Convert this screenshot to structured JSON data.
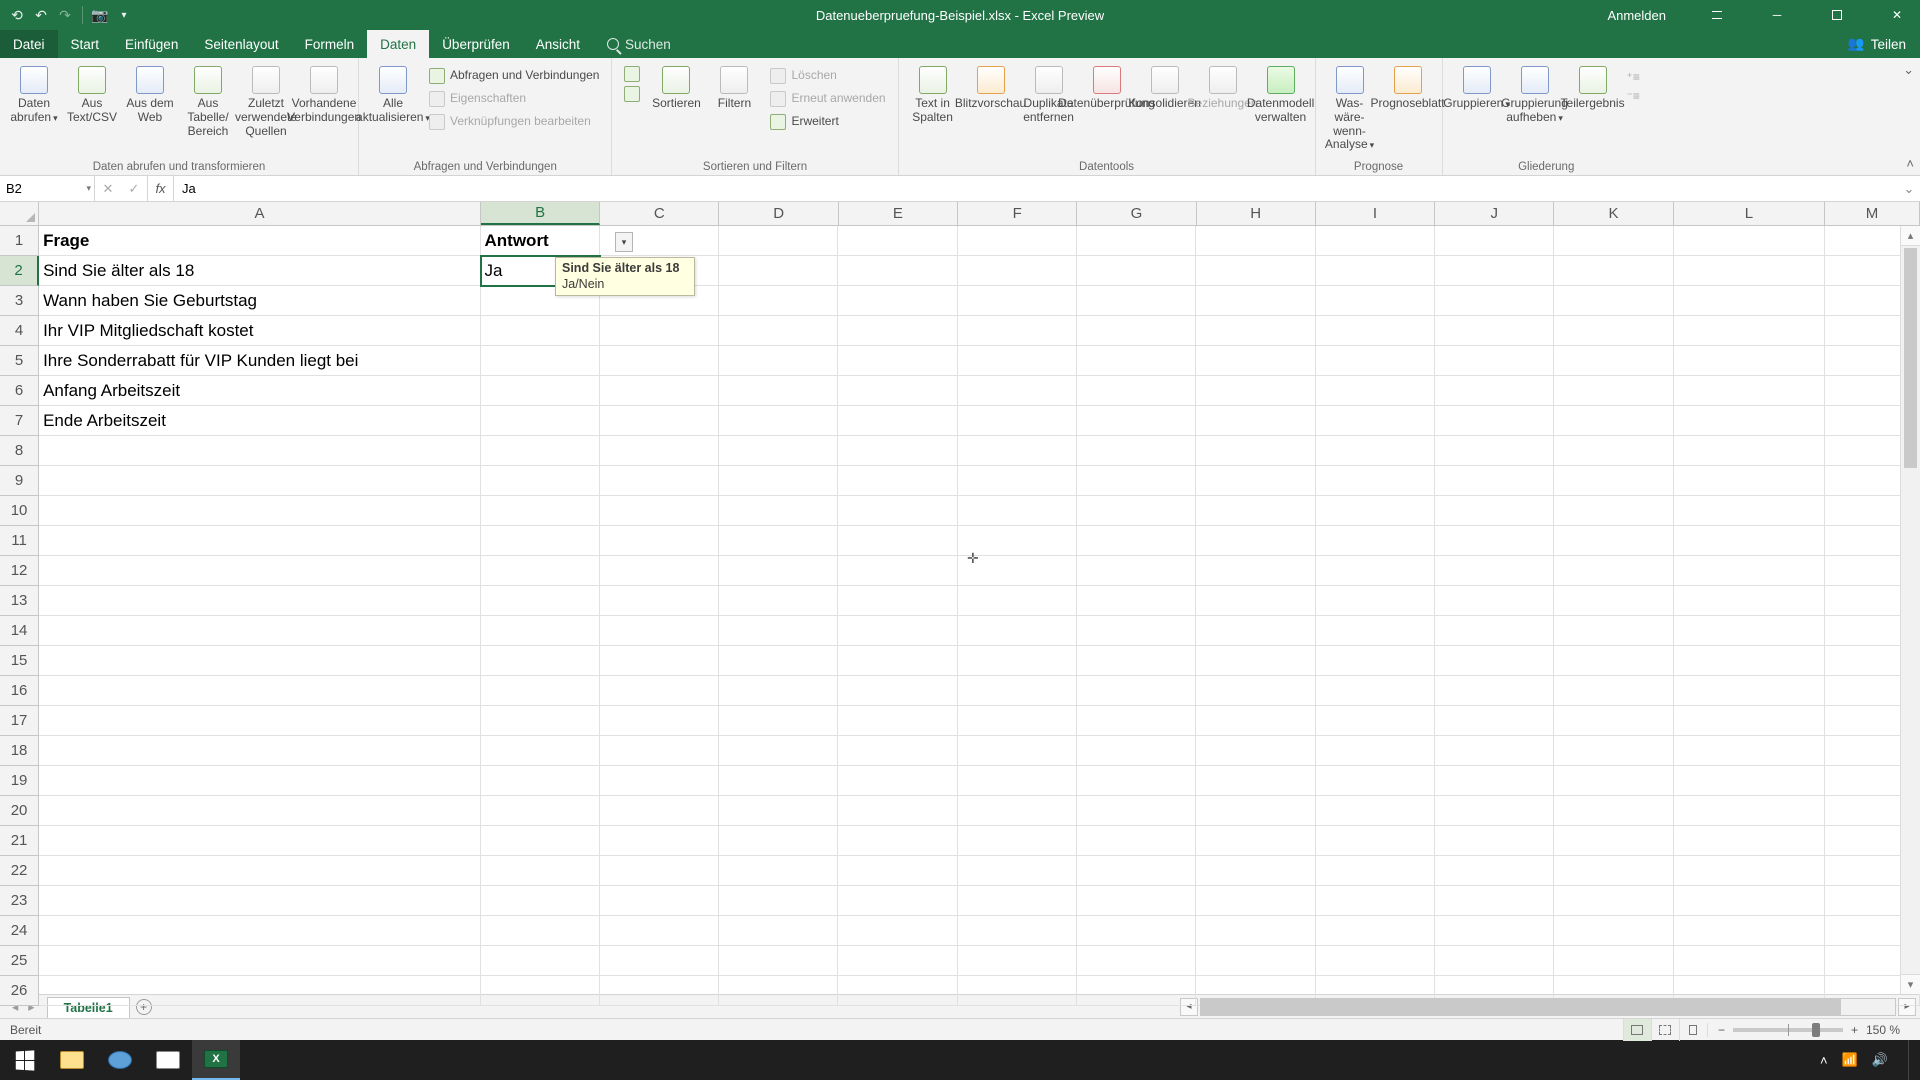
{
  "title": "Datenueberpruefung-Beispiel.xlsx  -  Excel Preview",
  "signin": "Anmelden",
  "tabs": {
    "datei": "Datei",
    "start": "Start",
    "einfuegen": "Einfügen",
    "seitenlayout": "Seitenlayout",
    "formeln": "Formeln",
    "daten": "Daten",
    "ueberpruefen": "Überprüfen",
    "ansicht": "Ansicht",
    "tellme_placeholder": "Suchen",
    "share": "Teilen"
  },
  "ribbon": {
    "group_get": {
      "label": "Daten abrufen und transformieren",
      "btn1": "Daten abrufen",
      "btn1_sub": "▾",
      "btn2": "Aus Text/CSV",
      "btn3": "Aus dem Web",
      "btn4": "Aus Tabelle/ Bereich",
      "btn5": "Zuletzt verwendete Quellen",
      "btn6": "Vorhandene Verbindungen"
    },
    "group_conn": {
      "label": "Abfragen und Verbindungen",
      "btn1": "Alle aktualisieren",
      "btn1_sub": "▾",
      "s1": "Abfragen und Verbindungen",
      "s2": "Eigenschaften",
      "s3": "Verknüpfungen bearbeiten"
    },
    "group_sort": {
      "label": "Sortieren und Filtern",
      "az": "A→Z",
      "za": "Z→A",
      "sort": "Sortieren",
      "filter": "Filtern",
      "s1": "Löschen",
      "s2": "Erneut anwenden",
      "s3": "Erweitert"
    },
    "group_tools": {
      "label": "Datentools",
      "b1": "Text in Spalten",
      "b2": "Blitzvorschau",
      "b3": "Duplikate entfernen",
      "b4": "Datenüberprüfung",
      "b5": "Konsolidieren",
      "b6": "Beziehungen",
      "b7": "Datenmodell verwalten"
    },
    "group_forecast": {
      "label": "Prognose",
      "b1": "Was-wäre-wenn-Analyse",
      "b1_sub": "▾",
      "b2": "Prognoseblatt"
    },
    "group_outline": {
      "label": "Gliederung",
      "b1": "Gruppieren",
      "b2": "Gruppierung aufheben",
      "b3": "Teilergebnis",
      "sub": "▾"
    }
  },
  "namebox": "B2",
  "formula": "Ja",
  "columns": [
    "A",
    "B",
    "C",
    "D",
    "E",
    "F",
    "G",
    "H",
    "I",
    "J",
    "K",
    "L",
    "M"
  ],
  "sheet": {
    "r1": {
      "A": "Frage",
      "B": "Antwort"
    },
    "r2": {
      "A": "Sind Sie älter als 18",
      "B": "Ja"
    },
    "r3": {
      "A": "Wann haben Sie Geburtstag"
    },
    "r4": {
      "A": "Ihr VIP Mitgliedschaft kostet"
    },
    "r5": {
      "A": "Ihre Sonderrabatt für VIP Kunden liegt bei"
    },
    "r6": {
      "A": "Anfang Arbeitszeit"
    },
    "r7": {
      "A": "Ende Arbeitszeit"
    }
  },
  "validation_note": {
    "title": "Sind Sie älter als 18",
    "body": "Ja/Nein"
  },
  "sheet_tab": "Tabelle1",
  "status": "Bereit",
  "zoom": "150 %"
}
